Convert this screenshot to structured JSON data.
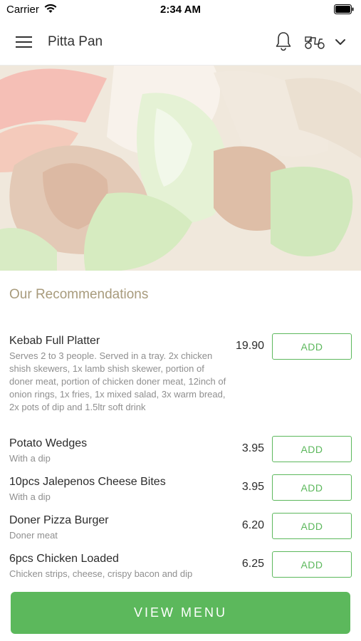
{
  "status_bar": {
    "carrier": "Carrier",
    "time": "2:34 AM"
  },
  "header": {
    "title": "Pitta Pan",
    "icons": [
      "menu-icon",
      "bell-icon",
      "scooter-icon",
      "chevron-down-icon"
    ]
  },
  "hero": {
    "icon": "kebab-food-photo"
  },
  "recommendations": {
    "title": "Our Recommendations",
    "add_label": "ADD",
    "items": [
      {
        "name": "Kebab Full Platter",
        "description": "Serves 2 to 3 people. Served in a tray. 2x chicken shish skewers, 1x lamb shish skewer, portion of doner meat, portion of chicken doner meat, 12inch of onion rings, 1x fries, 1x mixed salad, 3x warm bread, 2x pots of dip and 1.5ltr soft drink",
        "price": "19.90"
      },
      {
        "name": "Potato Wedges",
        "description": "With a dip",
        "price": "3.95"
      },
      {
        "name": "10pcs Jalepenos Cheese Bites",
        "description": "With a dip",
        "price": "3.95"
      },
      {
        "name": "Doner Pizza Burger",
        "description": "Doner meat",
        "price": "6.20"
      },
      {
        "name": "6pcs Chicken Loaded",
        "description": "Chicken strips, cheese, crispy bacon and dip",
        "price": "6.25"
      }
    ]
  },
  "footer": {
    "view_menu_label": "VIEW MENU"
  },
  "colors": {
    "accent_green": "#5cb85c",
    "section_title": "#a89b7c"
  }
}
